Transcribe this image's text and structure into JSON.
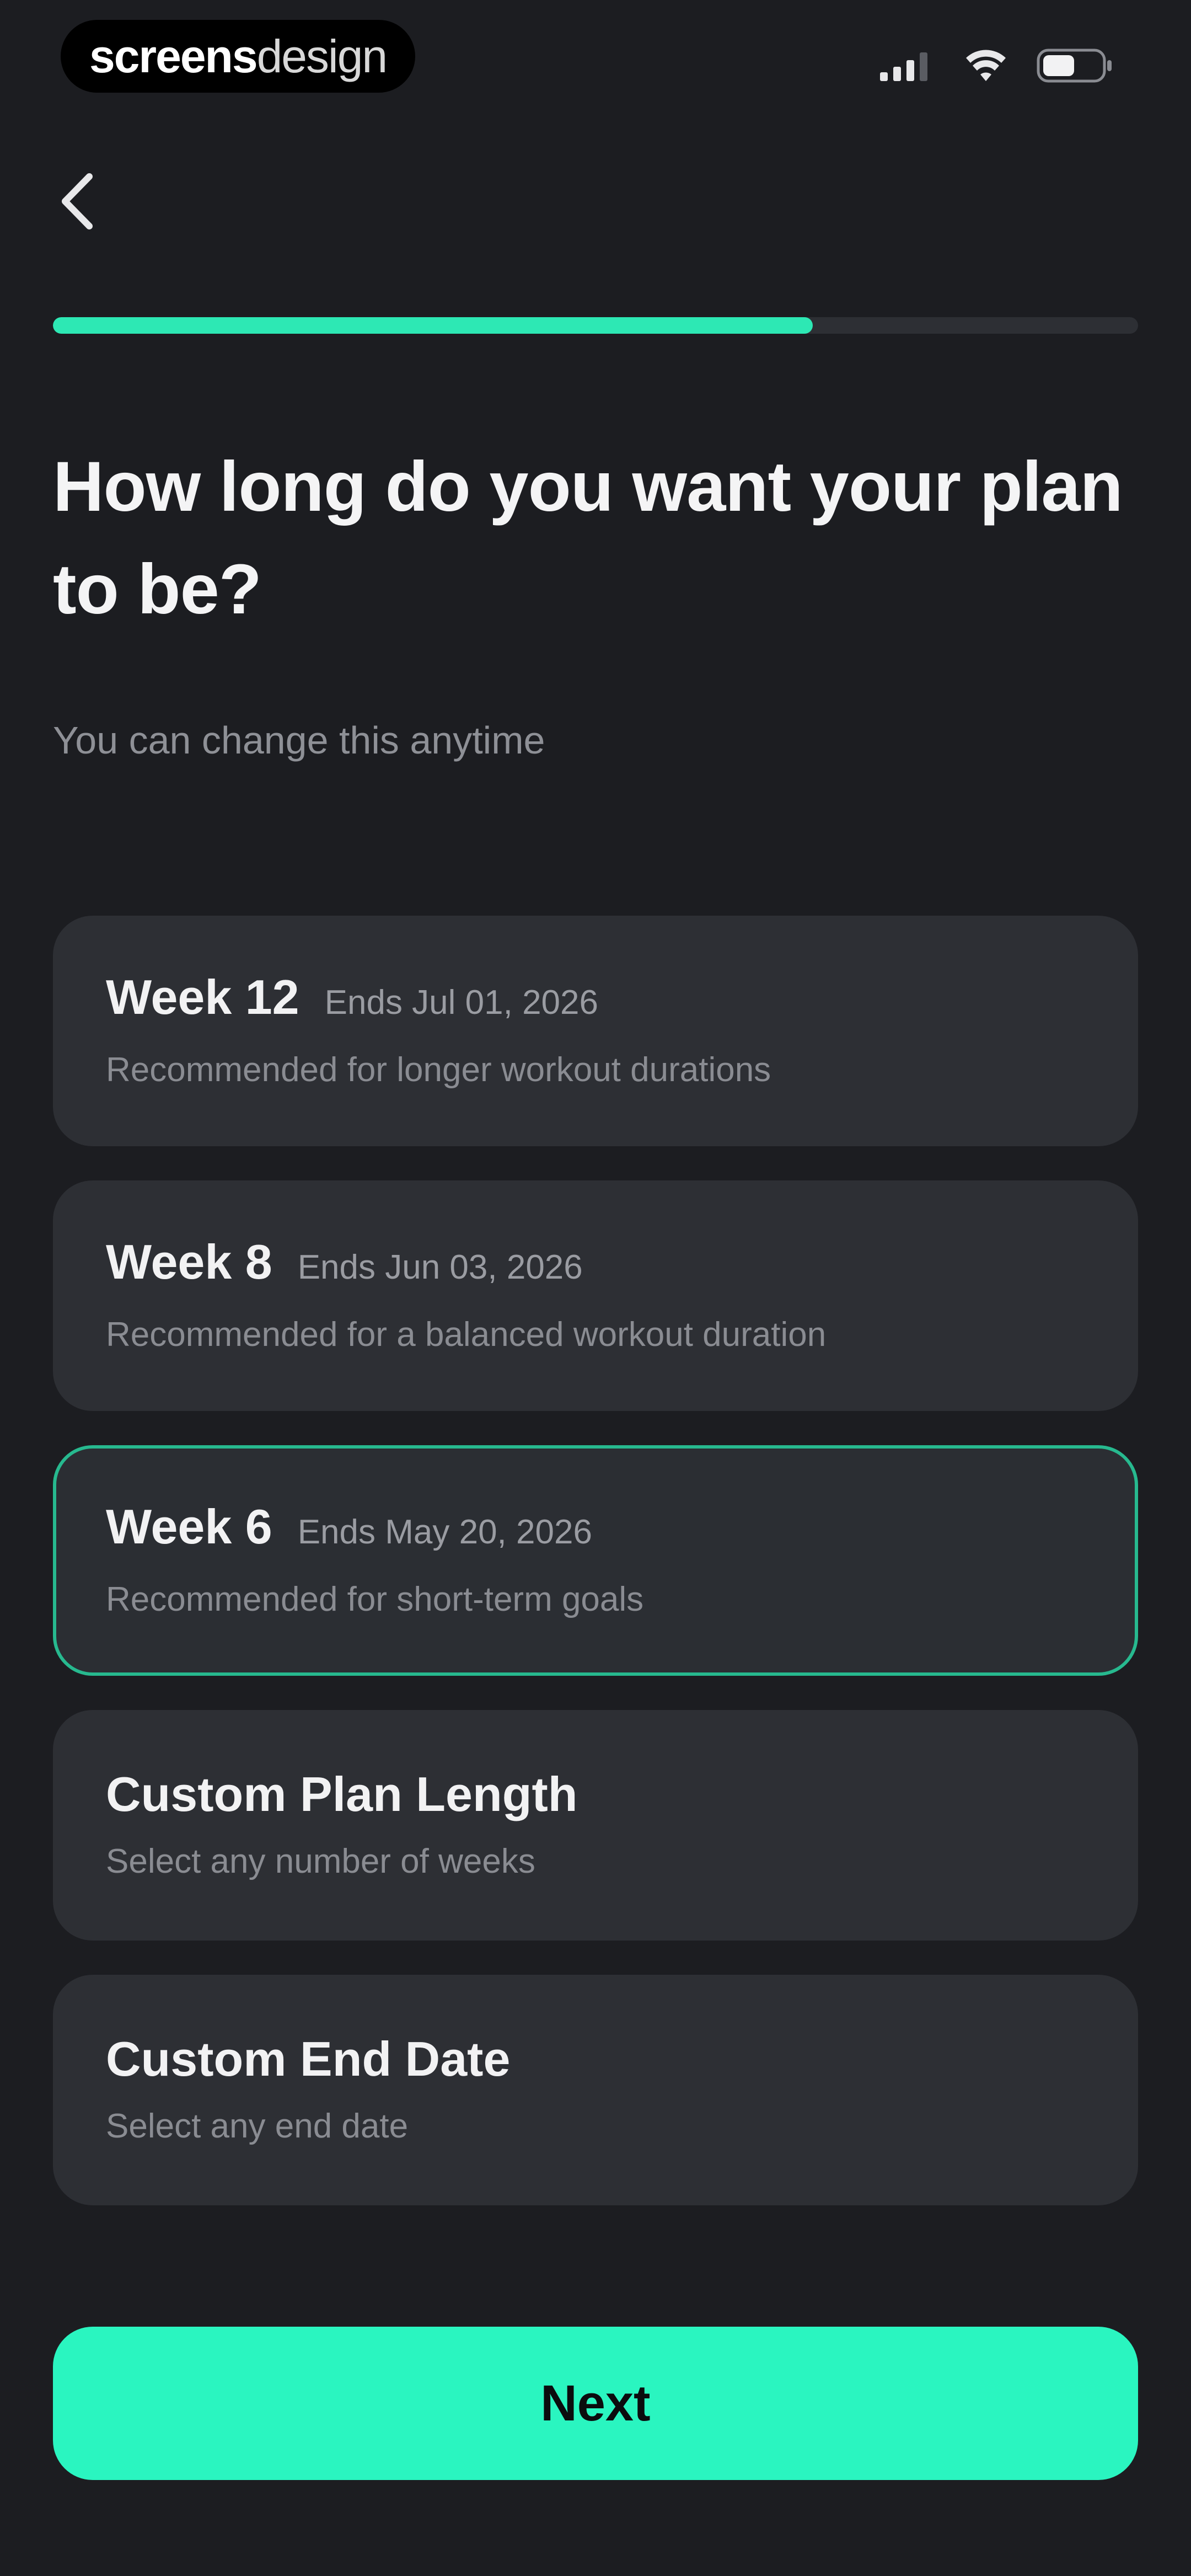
{
  "status_bar": {
    "brand_strong": "screens",
    "brand_light": "design",
    "icons": [
      "signal-icon",
      "wifi-icon",
      "battery-icon"
    ]
  },
  "nav": {
    "back_icon": "chevron-left-icon"
  },
  "progress": {
    "value_percent": 70
  },
  "header": {
    "title": "How long do you want your plan to be?",
    "subtitle": "You can change this anytime"
  },
  "options": [
    {
      "title": "Week 12",
      "date": "Ends Jul 01, 2026",
      "description": "Recommended for longer workout durations",
      "selected": false
    },
    {
      "title": "Week 8",
      "date": "Ends Jun 03, 2026",
      "description": "Recommended for a balanced workout duration",
      "selected": false
    },
    {
      "title": "Week 6",
      "date": "Ends May 20, 2026",
      "description": "Recommended for short-term goals",
      "selected": true
    },
    {
      "title": "Custom Plan Length",
      "date": "",
      "description": "Select any number of weeks",
      "selected": false
    },
    {
      "title": "Custom End Date",
      "date": "",
      "description": "Select any end date",
      "selected": false
    }
  ],
  "footer": {
    "next_label": "Next"
  },
  "colors": {
    "background": "#1c1d21",
    "card": "#2d2f34",
    "accent": "#2af5c0",
    "progress": "#2de8b4",
    "selected_border": "#27b98f"
  }
}
